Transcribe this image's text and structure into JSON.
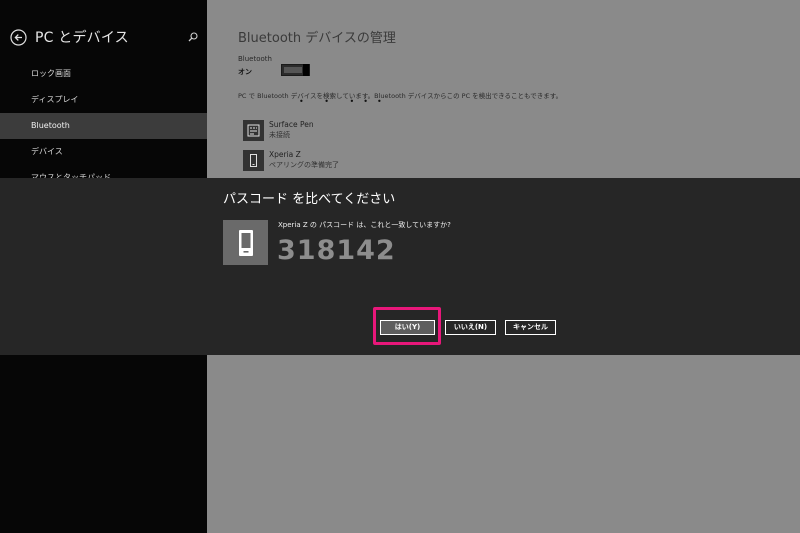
{
  "sidebar": {
    "title": "PC とデバイス",
    "items": [
      {
        "label": "ロック画面"
      },
      {
        "label": "ディスプレイ"
      },
      {
        "label": "Bluetooth"
      },
      {
        "label": "デバイス"
      },
      {
        "label": "マウスとタッチパッド"
      }
    ],
    "active_index": 2
  },
  "content": {
    "title": "Bluetooth デバイスの管理",
    "bluetooth_label": "Bluetooth",
    "bluetooth_state": "オン",
    "searching_text": "PC で Bluetooth デバイスを検索しています。Bluetooth デバイスからこの PC を検出できることもできます。",
    "progress_dots": "• • •••",
    "devices": [
      {
        "name": "Surface Pen",
        "status": "未接続",
        "icon": "keyboard-icon"
      },
      {
        "name": "Xperia Z",
        "status": "ペアリングの準備完了",
        "icon": "phone-icon"
      }
    ]
  },
  "dialog": {
    "title": "パスコード を比べてください",
    "message": "Xperia Z の パスコード は、これと一致していますか?",
    "passcode": "318142",
    "buttons": {
      "yes": "はい(Y)",
      "no": "いいえ(N)",
      "cancel": "キャンセル"
    }
  },
  "colors": {
    "sidebar_bg": "#060606",
    "content_bg": "#8a8a8a",
    "dialog_bg": "#262626",
    "passcode": "#8d8d8d",
    "highlight": "#e8177a"
  }
}
